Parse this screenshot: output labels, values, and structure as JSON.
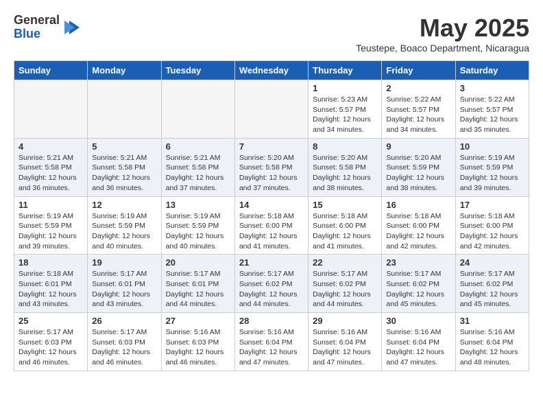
{
  "header": {
    "logo_general": "General",
    "logo_blue": "Blue",
    "month_year": "May 2025",
    "location": "Teustepe, Boaco Department, Nicaragua"
  },
  "days_of_week": [
    "Sunday",
    "Monday",
    "Tuesday",
    "Wednesday",
    "Thursday",
    "Friday",
    "Saturday"
  ],
  "weeks": [
    [
      {
        "day": "",
        "info": ""
      },
      {
        "day": "",
        "info": ""
      },
      {
        "day": "",
        "info": ""
      },
      {
        "day": "",
        "info": ""
      },
      {
        "day": "1",
        "info": "Sunrise: 5:23 AM\nSunset: 5:57 PM\nDaylight: 12 hours\nand 34 minutes."
      },
      {
        "day": "2",
        "info": "Sunrise: 5:22 AM\nSunset: 5:57 PM\nDaylight: 12 hours\nand 34 minutes."
      },
      {
        "day": "3",
        "info": "Sunrise: 5:22 AM\nSunset: 5:57 PM\nDaylight: 12 hours\nand 35 minutes."
      }
    ],
    [
      {
        "day": "4",
        "info": "Sunrise: 5:21 AM\nSunset: 5:58 PM\nDaylight: 12 hours\nand 36 minutes."
      },
      {
        "day": "5",
        "info": "Sunrise: 5:21 AM\nSunset: 5:58 PM\nDaylight: 12 hours\nand 36 minutes."
      },
      {
        "day": "6",
        "info": "Sunrise: 5:21 AM\nSunset: 5:58 PM\nDaylight: 12 hours\nand 37 minutes."
      },
      {
        "day": "7",
        "info": "Sunrise: 5:20 AM\nSunset: 5:58 PM\nDaylight: 12 hours\nand 37 minutes."
      },
      {
        "day": "8",
        "info": "Sunrise: 5:20 AM\nSunset: 5:58 PM\nDaylight: 12 hours\nand 38 minutes."
      },
      {
        "day": "9",
        "info": "Sunrise: 5:20 AM\nSunset: 5:59 PM\nDaylight: 12 hours\nand 38 minutes."
      },
      {
        "day": "10",
        "info": "Sunrise: 5:19 AM\nSunset: 5:59 PM\nDaylight: 12 hours\nand 39 minutes."
      }
    ],
    [
      {
        "day": "11",
        "info": "Sunrise: 5:19 AM\nSunset: 5:59 PM\nDaylight: 12 hours\nand 39 minutes."
      },
      {
        "day": "12",
        "info": "Sunrise: 5:19 AM\nSunset: 5:59 PM\nDaylight: 12 hours\nand 40 minutes."
      },
      {
        "day": "13",
        "info": "Sunrise: 5:19 AM\nSunset: 5:59 PM\nDaylight: 12 hours\nand 40 minutes."
      },
      {
        "day": "14",
        "info": "Sunrise: 5:18 AM\nSunset: 6:00 PM\nDaylight: 12 hours\nand 41 minutes."
      },
      {
        "day": "15",
        "info": "Sunrise: 5:18 AM\nSunset: 6:00 PM\nDaylight: 12 hours\nand 41 minutes."
      },
      {
        "day": "16",
        "info": "Sunrise: 5:18 AM\nSunset: 6:00 PM\nDaylight: 12 hours\nand 42 minutes."
      },
      {
        "day": "17",
        "info": "Sunrise: 5:18 AM\nSunset: 6:00 PM\nDaylight: 12 hours\nand 42 minutes."
      }
    ],
    [
      {
        "day": "18",
        "info": "Sunrise: 5:18 AM\nSunset: 6:01 PM\nDaylight: 12 hours\nand 43 minutes."
      },
      {
        "day": "19",
        "info": "Sunrise: 5:17 AM\nSunset: 6:01 PM\nDaylight: 12 hours\nand 43 minutes."
      },
      {
        "day": "20",
        "info": "Sunrise: 5:17 AM\nSunset: 6:01 PM\nDaylight: 12 hours\nand 44 minutes."
      },
      {
        "day": "21",
        "info": "Sunrise: 5:17 AM\nSunset: 6:02 PM\nDaylight: 12 hours\nand 44 minutes."
      },
      {
        "day": "22",
        "info": "Sunrise: 5:17 AM\nSunset: 6:02 PM\nDaylight: 12 hours\nand 44 minutes."
      },
      {
        "day": "23",
        "info": "Sunrise: 5:17 AM\nSunset: 6:02 PM\nDaylight: 12 hours\nand 45 minutes."
      },
      {
        "day": "24",
        "info": "Sunrise: 5:17 AM\nSunset: 6:02 PM\nDaylight: 12 hours\nand 45 minutes."
      }
    ],
    [
      {
        "day": "25",
        "info": "Sunrise: 5:17 AM\nSunset: 6:03 PM\nDaylight: 12 hours\nand 46 minutes."
      },
      {
        "day": "26",
        "info": "Sunrise: 5:17 AM\nSunset: 6:03 PM\nDaylight: 12 hours\nand 46 minutes."
      },
      {
        "day": "27",
        "info": "Sunrise: 5:16 AM\nSunset: 6:03 PM\nDaylight: 12 hours\nand 46 minutes."
      },
      {
        "day": "28",
        "info": "Sunrise: 5:16 AM\nSunset: 6:04 PM\nDaylight: 12 hours\nand 47 minutes."
      },
      {
        "day": "29",
        "info": "Sunrise: 5:16 AM\nSunset: 6:04 PM\nDaylight: 12 hours\nand 47 minutes."
      },
      {
        "day": "30",
        "info": "Sunrise: 5:16 AM\nSunset: 6:04 PM\nDaylight: 12 hours\nand 47 minutes."
      },
      {
        "day": "31",
        "info": "Sunrise: 5:16 AM\nSunset: 6:04 PM\nDaylight: 12 hours\nand 48 minutes."
      }
    ]
  ]
}
